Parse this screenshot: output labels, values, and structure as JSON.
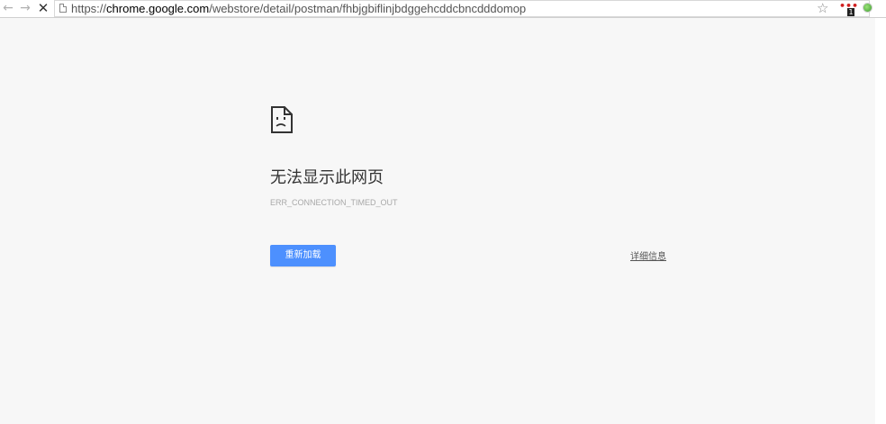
{
  "toolbar": {
    "back_icon": "arrow-left-icon",
    "forward_icon": "arrow-right-icon",
    "stop_icon": "close-icon",
    "url_prefix": "https://",
    "url_host": "chrome.google.com",
    "url_path": "/webstore/detail/postman/fhbjgbiflinjbdggehcddcbncdddomop",
    "ext_badge": "1"
  },
  "error": {
    "title": "无法显示此网页",
    "code": "ERR_CONNECTION_TIMED_OUT",
    "reload_label": "重新加载",
    "details_label": "详细信息"
  },
  "colors": {
    "page_bg": "#f7f7f7",
    "button_blue": "#4d90fe"
  }
}
